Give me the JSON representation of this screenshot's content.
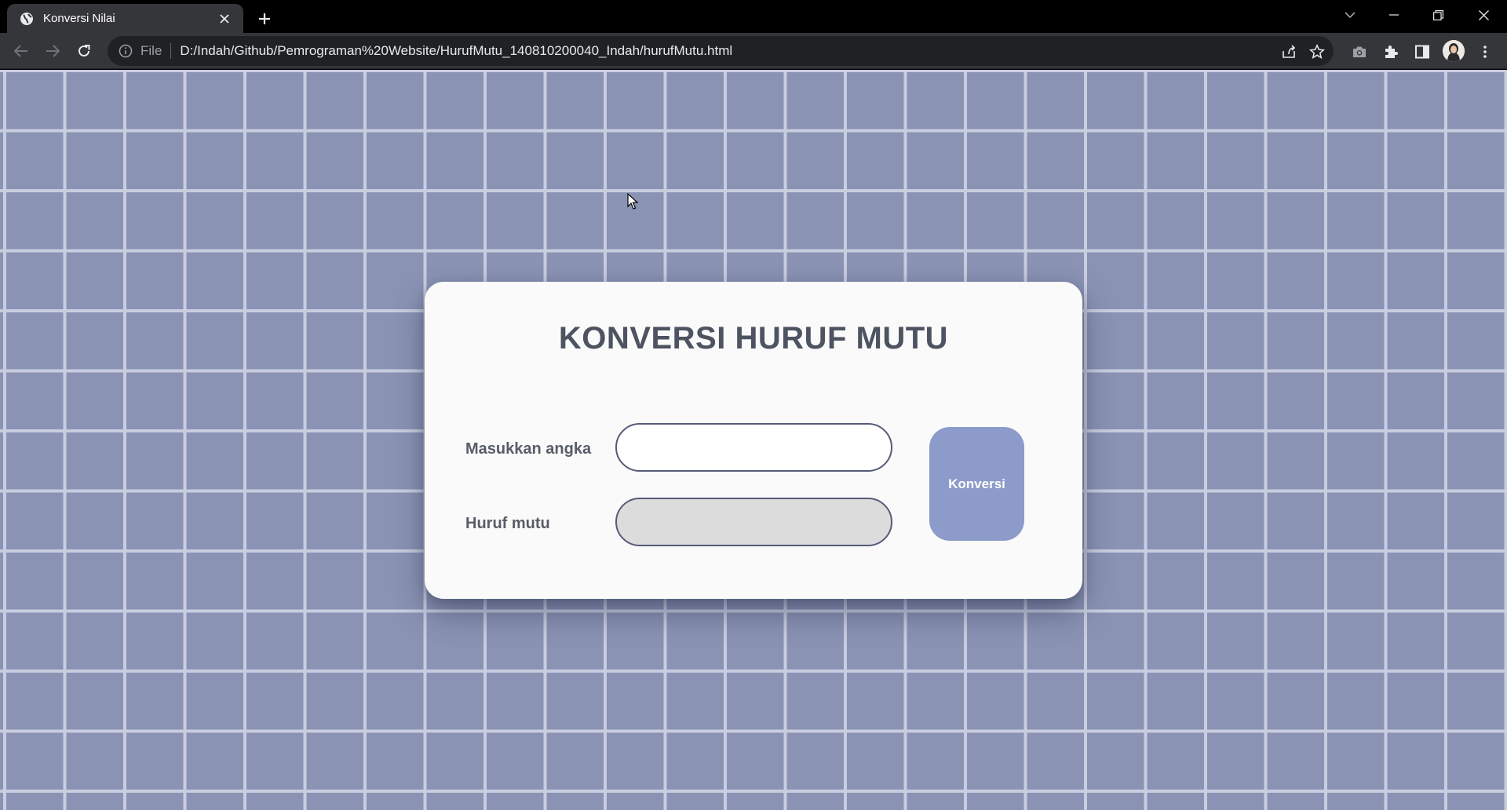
{
  "browser": {
    "tab_title": "Konversi Nilai",
    "address_scheme_label": "File",
    "address_url": "D:/Indah/Github/Pemrograman%20Website/HurufMutu_140810200040_Indah/hurufMutu.html"
  },
  "page": {
    "title": "KONVERSI HURUF MUTU",
    "input_label": "Masukkan angka",
    "input_value": "",
    "output_label": "Huruf mutu",
    "output_value": "",
    "convert_button": "Konversi"
  },
  "colors": {
    "background": "#8a93b4",
    "grid_lines": "#c9cde0",
    "card": "#fafafa",
    "button": "#8c9bc9",
    "input_border": "#565b78",
    "output_fill": "#dcdcdc"
  }
}
